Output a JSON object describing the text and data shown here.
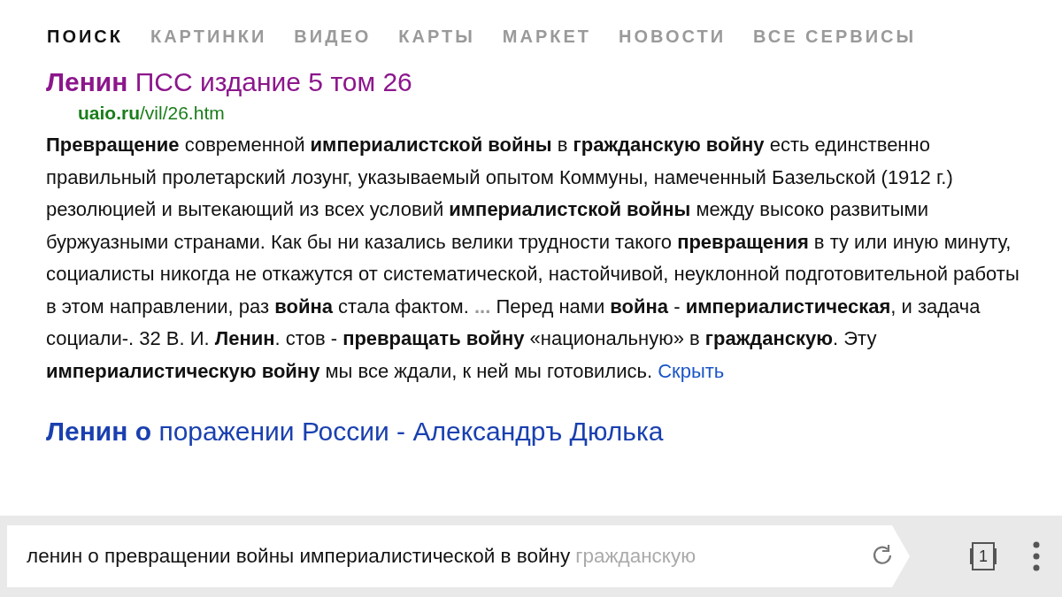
{
  "tabs": [
    {
      "label": "ПОИСК",
      "selected": true
    },
    {
      "label": "КАРТИНКИ",
      "selected": false
    },
    {
      "label": "ВИДЕО",
      "selected": false
    },
    {
      "label": "КАРТЫ",
      "selected": false
    },
    {
      "label": "МАРКЕТ",
      "selected": false
    },
    {
      "label": "НОВОСТИ",
      "selected": false
    },
    {
      "label": "ВСЕ СЕРВИСЫ",
      "selected": false
    }
  ],
  "results": [
    {
      "title": "**Ленин** ПСС издание 5 том 26",
      "url": "**uaio.ru**/vil/26.htm",
      "snippet_before": "**Превращение** современной **империалистской войны** в **гражданскую войну** есть единственно правильный пролетарский лозунг, указываемый опытом Коммуны, намеченный Базельской (1912 г.) резолюцией и вытекающий из всех условий **империалистской войны** между высоко развитыми буржуазными странами. Как бы ни казались велики трудности такого **превращения** в ту или иную минуту, социалисты никогда не откажутся от систематической, настойчивой, неуклонной подготовительной работы в этом направлении, раз **война** стала фактом.",
      "ellipsis": "...",
      "snippet_after": "Перед нами **война** - **империалистическая**, и задача социали-. 32 В. И. **Ленин**. стов - **превращать войну** «национальную» в **гражданскую**. Эту **империалистическую войну** мы все ждали, к ней мы готовились.",
      "hide_link": "Скрыть"
    },
    {
      "title": "**Ленин о** поражении России - Александръ Дюлька"
    }
  ],
  "address_bar": {
    "query": "ленин о превращении войны империалистической в войну",
    "query_faded": "гражданскую",
    "tab_count": "1"
  }
}
